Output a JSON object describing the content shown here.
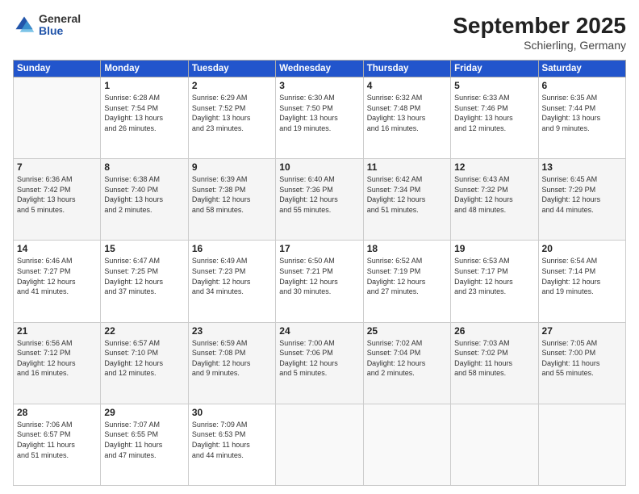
{
  "header": {
    "logo": {
      "general": "General",
      "blue": "Blue"
    },
    "month": "September 2025",
    "location": "Schierling, Germany"
  },
  "weekdays": [
    "Sunday",
    "Monday",
    "Tuesday",
    "Wednesday",
    "Thursday",
    "Friday",
    "Saturday"
  ],
  "weeks": [
    [
      {
        "day": "",
        "info": ""
      },
      {
        "day": "1",
        "info": "Sunrise: 6:28 AM\nSunset: 7:54 PM\nDaylight: 13 hours\nand 26 minutes."
      },
      {
        "day": "2",
        "info": "Sunrise: 6:29 AM\nSunset: 7:52 PM\nDaylight: 13 hours\nand 23 minutes."
      },
      {
        "day": "3",
        "info": "Sunrise: 6:30 AM\nSunset: 7:50 PM\nDaylight: 13 hours\nand 19 minutes."
      },
      {
        "day": "4",
        "info": "Sunrise: 6:32 AM\nSunset: 7:48 PM\nDaylight: 13 hours\nand 16 minutes."
      },
      {
        "day": "5",
        "info": "Sunrise: 6:33 AM\nSunset: 7:46 PM\nDaylight: 13 hours\nand 12 minutes."
      },
      {
        "day": "6",
        "info": "Sunrise: 6:35 AM\nSunset: 7:44 PM\nDaylight: 13 hours\nand 9 minutes."
      }
    ],
    [
      {
        "day": "7",
        "info": "Sunrise: 6:36 AM\nSunset: 7:42 PM\nDaylight: 13 hours\nand 5 minutes."
      },
      {
        "day": "8",
        "info": "Sunrise: 6:38 AM\nSunset: 7:40 PM\nDaylight: 13 hours\nand 2 minutes."
      },
      {
        "day": "9",
        "info": "Sunrise: 6:39 AM\nSunset: 7:38 PM\nDaylight: 12 hours\nand 58 minutes."
      },
      {
        "day": "10",
        "info": "Sunrise: 6:40 AM\nSunset: 7:36 PM\nDaylight: 12 hours\nand 55 minutes."
      },
      {
        "day": "11",
        "info": "Sunrise: 6:42 AM\nSunset: 7:34 PM\nDaylight: 12 hours\nand 51 minutes."
      },
      {
        "day": "12",
        "info": "Sunrise: 6:43 AM\nSunset: 7:32 PM\nDaylight: 12 hours\nand 48 minutes."
      },
      {
        "day": "13",
        "info": "Sunrise: 6:45 AM\nSunset: 7:29 PM\nDaylight: 12 hours\nand 44 minutes."
      }
    ],
    [
      {
        "day": "14",
        "info": "Sunrise: 6:46 AM\nSunset: 7:27 PM\nDaylight: 12 hours\nand 41 minutes."
      },
      {
        "day": "15",
        "info": "Sunrise: 6:47 AM\nSunset: 7:25 PM\nDaylight: 12 hours\nand 37 minutes."
      },
      {
        "day": "16",
        "info": "Sunrise: 6:49 AM\nSunset: 7:23 PM\nDaylight: 12 hours\nand 34 minutes."
      },
      {
        "day": "17",
        "info": "Sunrise: 6:50 AM\nSunset: 7:21 PM\nDaylight: 12 hours\nand 30 minutes."
      },
      {
        "day": "18",
        "info": "Sunrise: 6:52 AM\nSunset: 7:19 PM\nDaylight: 12 hours\nand 27 minutes."
      },
      {
        "day": "19",
        "info": "Sunrise: 6:53 AM\nSunset: 7:17 PM\nDaylight: 12 hours\nand 23 minutes."
      },
      {
        "day": "20",
        "info": "Sunrise: 6:54 AM\nSunset: 7:14 PM\nDaylight: 12 hours\nand 19 minutes."
      }
    ],
    [
      {
        "day": "21",
        "info": "Sunrise: 6:56 AM\nSunset: 7:12 PM\nDaylight: 12 hours\nand 16 minutes."
      },
      {
        "day": "22",
        "info": "Sunrise: 6:57 AM\nSunset: 7:10 PM\nDaylight: 12 hours\nand 12 minutes."
      },
      {
        "day": "23",
        "info": "Sunrise: 6:59 AM\nSunset: 7:08 PM\nDaylight: 12 hours\nand 9 minutes."
      },
      {
        "day": "24",
        "info": "Sunrise: 7:00 AM\nSunset: 7:06 PM\nDaylight: 12 hours\nand 5 minutes."
      },
      {
        "day": "25",
        "info": "Sunrise: 7:02 AM\nSunset: 7:04 PM\nDaylight: 12 hours\nand 2 minutes."
      },
      {
        "day": "26",
        "info": "Sunrise: 7:03 AM\nSunset: 7:02 PM\nDaylight: 11 hours\nand 58 minutes."
      },
      {
        "day": "27",
        "info": "Sunrise: 7:05 AM\nSunset: 7:00 PM\nDaylight: 11 hours\nand 55 minutes."
      }
    ],
    [
      {
        "day": "28",
        "info": "Sunrise: 7:06 AM\nSunset: 6:57 PM\nDaylight: 11 hours\nand 51 minutes."
      },
      {
        "day": "29",
        "info": "Sunrise: 7:07 AM\nSunset: 6:55 PM\nDaylight: 11 hours\nand 47 minutes."
      },
      {
        "day": "30",
        "info": "Sunrise: 7:09 AM\nSunset: 6:53 PM\nDaylight: 11 hours\nand 44 minutes."
      },
      {
        "day": "",
        "info": ""
      },
      {
        "day": "",
        "info": ""
      },
      {
        "day": "",
        "info": ""
      },
      {
        "day": "",
        "info": ""
      }
    ]
  ]
}
